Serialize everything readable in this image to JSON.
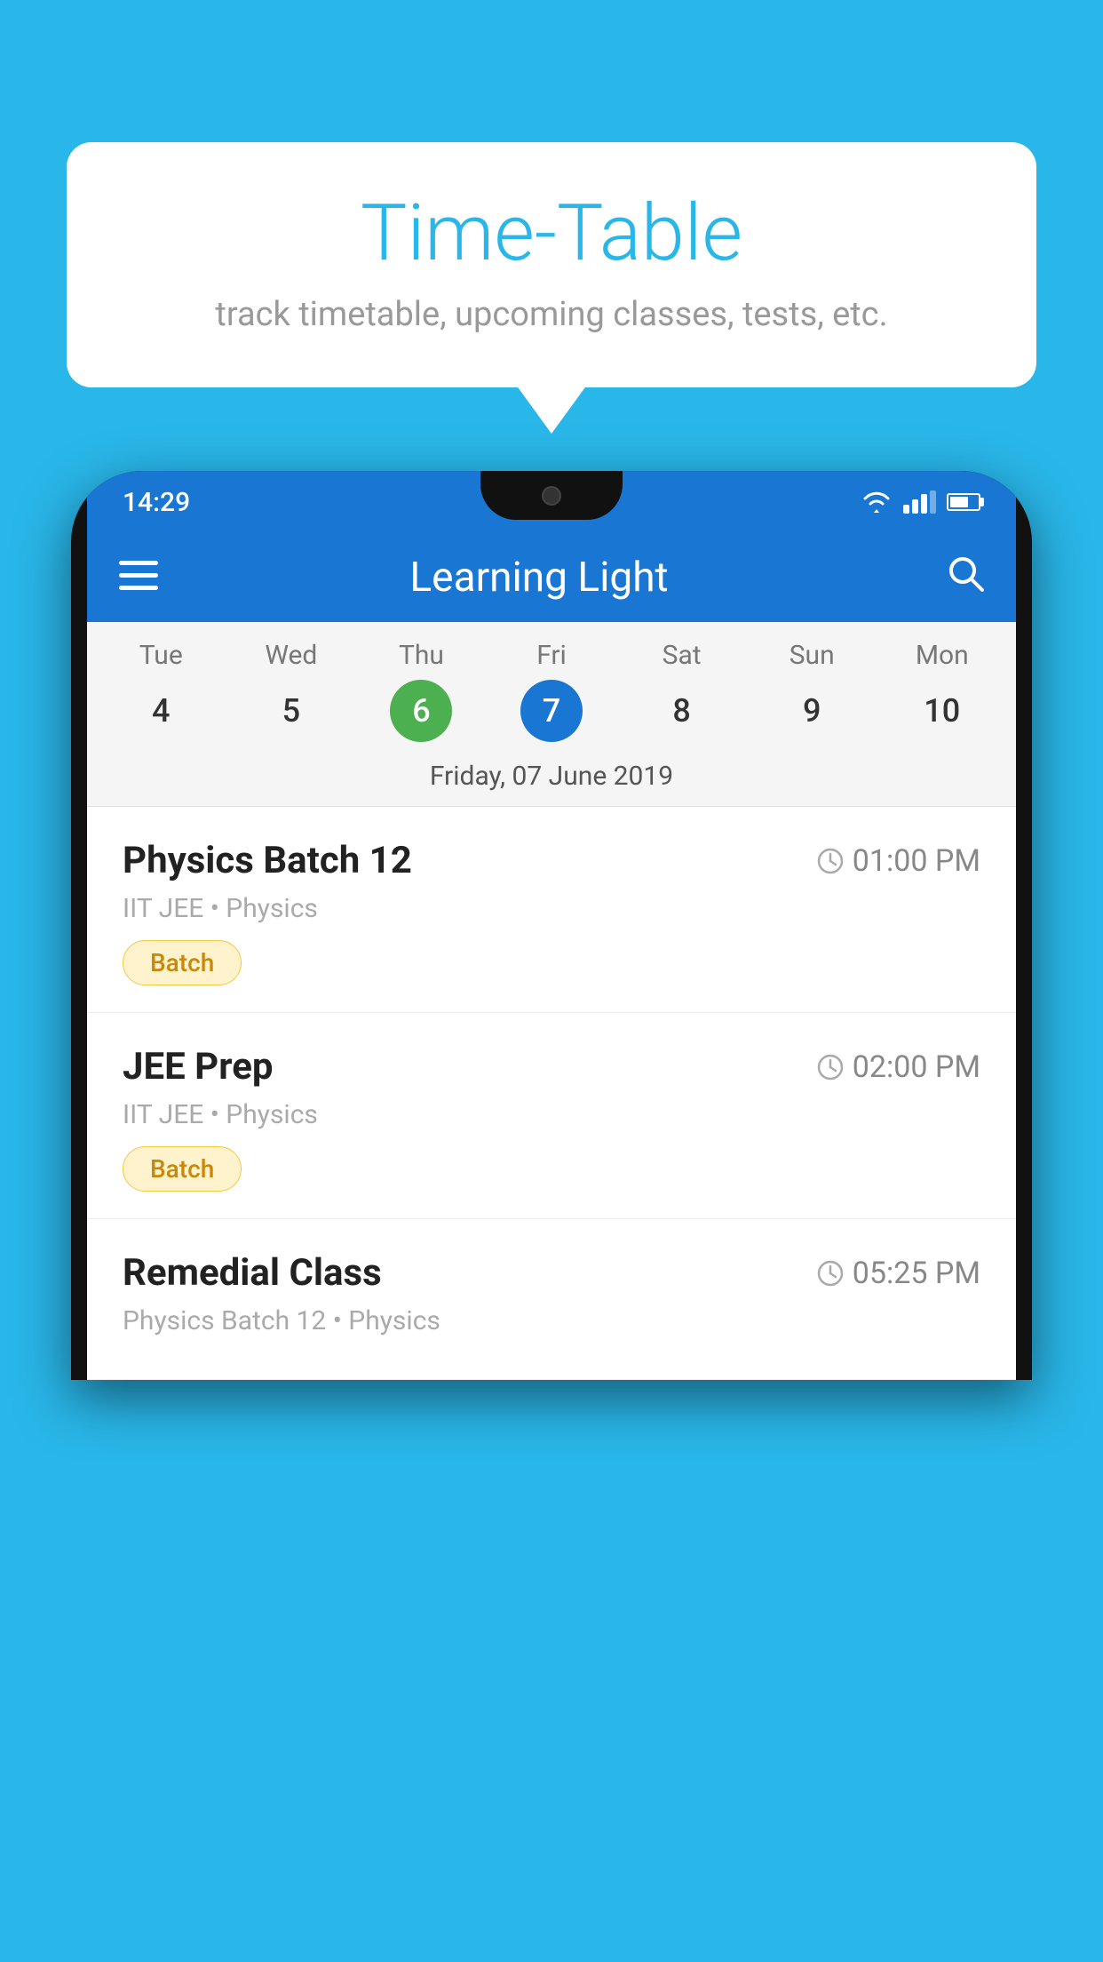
{
  "background_color": "#29b6e8",
  "bubble": {
    "title": "Time-Table",
    "subtitle": "track timetable, upcoming classes, tests, etc."
  },
  "phone": {
    "status_bar": {
      "time": "14:29"
    },
    "toolbar": {
      "app_name": "Learning Light",
      "hamburger_label": "≡",
      "search_label": "🔍"
    },
    "calendar": {
      "days": [
        {
          "name": "Tue",
          "num": "4",
          "state": "normal"
        },
        {
          "name": "Wed",
          "num": "5",
          "state": "normal"
        },
        {
          "name": "Thu",
          "num": "6",
          "state": "today"
        },
        {
          "name": "Fri",
          "num": "7",
          "state": "selected"
        },
        {
          "name": "Sat",
          "num": "8",
          "state": "normal"
        },
        {
          "name": "Sun",
          "num": "9",
          "state": "normal"
        },
        {
          "name": "Mon",
          "num": "10",
          "state": "normal"
        }
      ],
      "selected_date_label": "Friday, 07 June 2019"
    },
    "events": [
      {
        "name": "Physics Batch 12",
        "time": "01:00 PM",
        "meta": "IIT JEE • Physics",
        "badge": "Batch"
      },
      {
        "name": "JEE Prep",
        "time": "02:00 PM",
        "meta": "IIT JEE • Physics",
        "badge": "Batch"
      },
      {
        "name": "Remedial Class",
        "time": "05:25 PM",
        "meta": "Physics Batch 12 • Physics",
        "badge": ""
      }
    ]
  }
}
